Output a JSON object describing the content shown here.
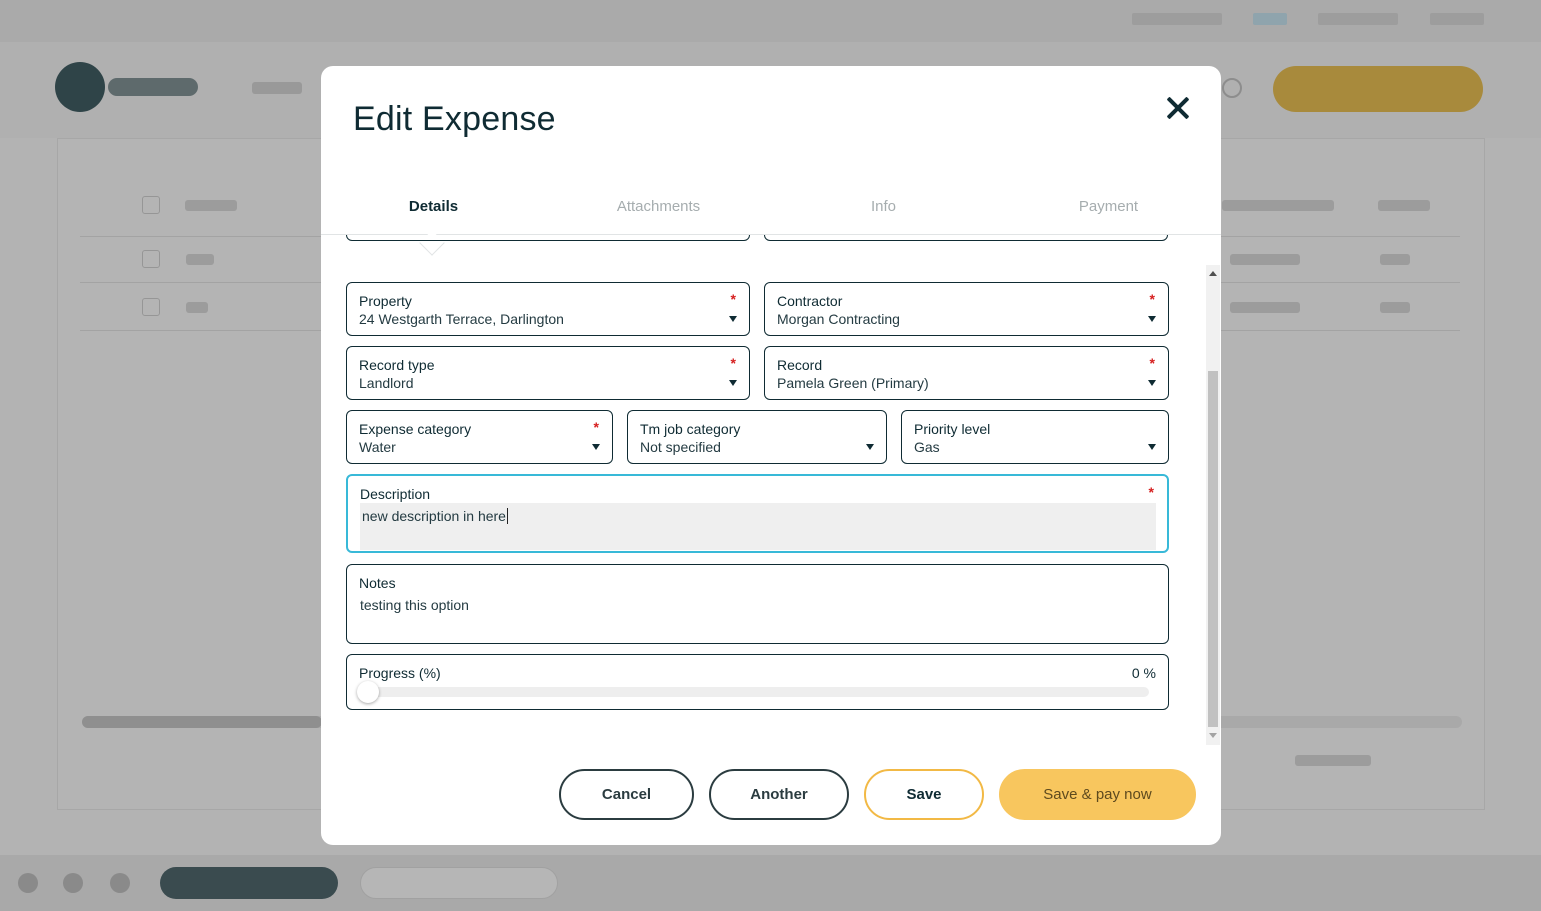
{
  "modal": {
    "title": "Edit Expense",
    "tabs": [
      {
        "label": "Details",
        "active": true
      },
      {
        "label": "Attachments",
        "active": false
      },
      {
        "label": "Info",
        "active": false
      },
      {
        "label": "Payment",
        "active": false
      }
    ]
  },
  "form": {
    "property": {
      "label": "Property",
      "value": "24 Westgarth Terrace, Darlington",
      "required": "*"
    },
    "contractor": {
      "label": "Contractor",
      "value": "Morgan Contracting",
      "required": "*"
    },
    "record_type": {
      "label": "Record type",
      "value": "Landlord",
      "required": "*"
    },
    "record": {
      "label": "Record",
      "value": "Pamela Green (Primary)",
      "required": "*"
    },
    "expense_category": {
      "label": "Expense category",
      "value": "Water",
      "required": "*"
    },
    "tm_job_category": {
      "label": "Tm job category",
      "value": "Not specified"
    },
    "priority_level": {
      "label": "Priority level",
      "value": "Gas"
    },
    "description": {
      "label": "Description",
      "value": "new description in here",
      "required": "*"
    },
    "notes": {
      "label": "Notes",
      "value": "testing this option"
    },
    "progress": {
      "label": "Progress (%)",
      "value_text": "0 %",
      "value": 0
    }
  },
  "buttons": {
    "cancel": "Cancel",
    "another": "Another",
    "save": "Save",
    "save_pay": "Save & pay now"
  },
  "colors": {
    "primary_text": "#0f2b33",
    "focus_border": "#38b9d8",
    "accent_yellow": "#f8c65e",
    "required_red": "#d62020"
  },
  "icons": [
    "close-icon",
    "chevron-down-icon",
    "scroll-up-arrow-icon",
    "scroll-down-arrow-icon"
  ]
}
